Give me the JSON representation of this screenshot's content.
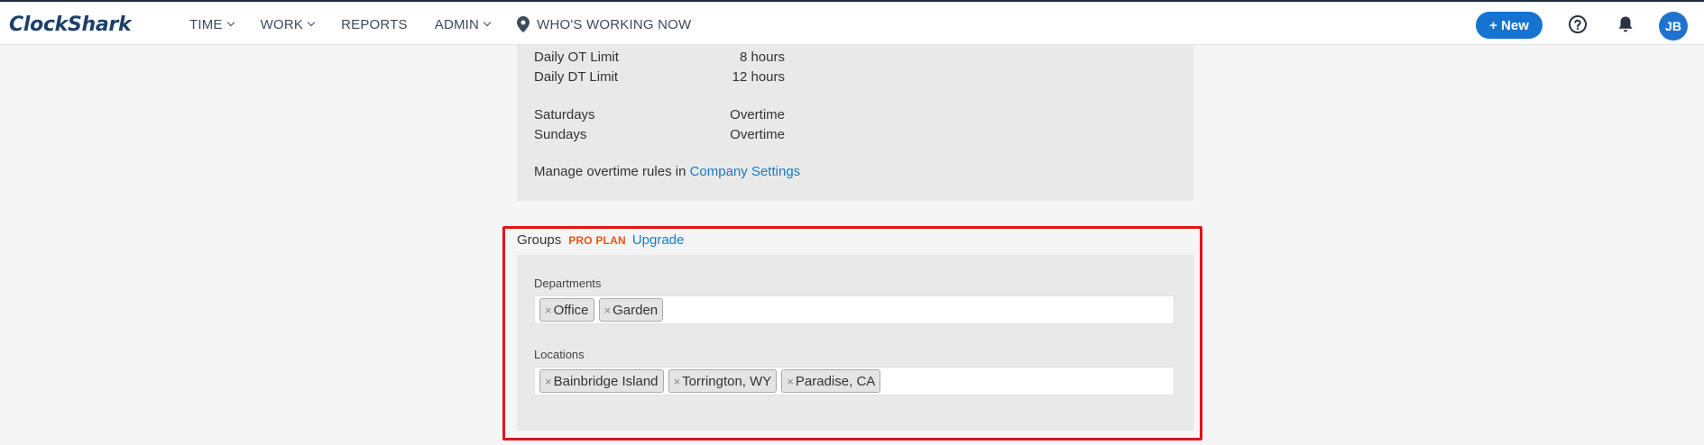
{
  "header": {
    "logo": "ClockShark",
    "nav": [
      {
        "label": "TIME",
        "has_menu": true
      },
      {
        "label": "WORK",
        "has_menu": true
      },
      {
        "label": "REPORTS",
        "has_menu": false
      },
      {
        "label": "ADMIN",
        "has_menu": true
      },
      {
        "label": "WHO'S WORKING NOW",
        "has_menu": false,
        "icon": "map-pin-icon"
      }
    ],
    "new_button": "+ New",
    "help_icon": "question-circle-icon",
    "bell_icon": "bell-icon",
    "avatar_initials": "JB"
  },
  "overtime": {
    "rows": [
      {
        "label": "Daily OT Limit",
        "value": "8 hours"
      },
      {
        "label": "Daily DT Limit",
        "value": "12 hours"
      },
      {
        "label": "Saturdays",
        "value": "Overtime"
      },
      {
        "label": "Sundays",
        "value": "Overtime"
      }
    ],
    "manage_text": "Manage overtime rules in ",
    "manage_link": "Company Settings"
  },
  "groups": {
    "title": "Groups",
    "plan_badge": "PRO PLAN",
    "upgrade_link": "Upgrade",
    "departments": {
      "label": "Departments",
      "chips": [
        "Office",
        "Garden"
      ]
    },
    "locations": {
      "label": "Locations",
      "chips": [
        "Bainbridge Island",
        "Torrington, WY",
        "Paradise, CA"
      ]
    },
    "chip_remove_glyph": "×"
  },
  "colors": {
    "brand_blue": "#1674d0",
    "link": "#1b7bbf",
    "pro_badge": "#e8541b",
    "highlight": "#e01418",
    "panel": "#e9e9e9"
  }
}
